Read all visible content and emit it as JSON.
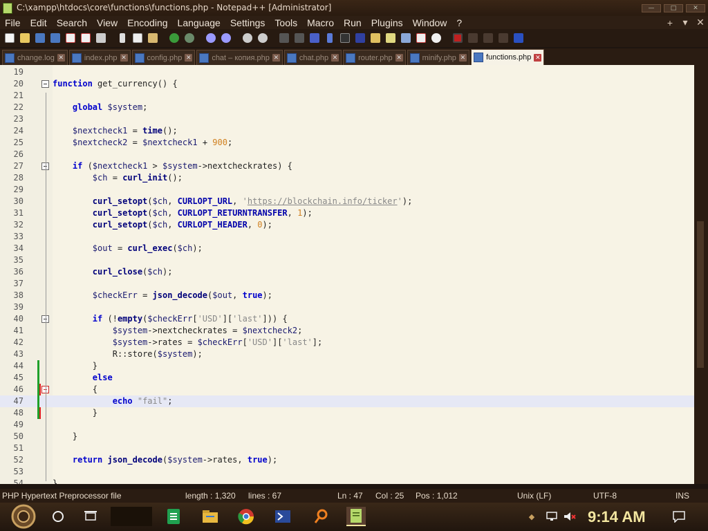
{
  "window": {
    "title": "C:\\xampp\\htdocs\\core\\functions\\functions.php - Notepad++ [Administrator]"
  },
  "menu": {
    "items": [
      "File",
      "Edit",
      "Search",
      "View",
      "Encoding",
      "Language",
      "Settings",
      "Tools",
      "Macro",
      "Run",
      "Plugins",
      "Window",
      "?"
    ],
    "right_controls": [
      "+",
      "▾",
      "✕"
    ]
  },
  "tabs": [
    {
      "label": "change.log",
      "active": false
    },
    {
      "label": "index.php",
      "active": false
    },
    {
      "label": "config.php",
      "active": false
    },
    {
      "label": "chat – копия.php",
      "active": false
    },
    {
      "label": "chat.php",
      "active": false
    },
    {
      "label": "router.php",
      "active": false
    },
    {
      "label": "minify.php",
      "active": false
    },
    {
      "label": "functions.php",
      "active": true
    }
  ],
  "editor": {
    "current_line": 47,
    "lines": [
      {
        "n": "19",
        "code": ""
      },
      {
        "n": "20",
        "code": "function get_currency() {"
      },
      {
        "n": "21",
        "code": ""
      },
      {
        "n": "22",
        "code": "    global $system;"
      },
      {
        "n": "23",
        "code": ""
      },
      {
        "n": "24",
        "code": "    $nextcheck1 = time();"
      },
      {
        "n": "25",
        "code": "    $nextcheck2 = $nextcheck1 + 900;"
      },
      {
        "n": "26",
        "code": ""
      },
      {
        "n": "27",
        "code": "    if ($nextcheck1 > $system->nextcheckrates) {"
      },
      {
        "n": "28",
        "code": "        $ch = curl_init();"
      },
      {
        "n": "29",
        "code": ""
      },
      {
        "n": "30",
        "code": "        curl_setopt($ch, CURLOPT_URL, 'https://blockchain.info/ticker');"
      },
      {
        "n": "31",
        "code": "        curl_setopt($ch, CURLOPT_RETURNTRANSFER, 1);"
      },
      {
        "n": "32",
        "code": "        curl_setopt($ch, CURLOPT_HEADER, 0);"
      },
      {
        "n": "33",
        "code": ""
      },
      {
        "n": "34",
        "code": "        $out = curl_exec($ch);"
      },
      {
        "n": "35",
        "code": ""
      },
      {
        "n": "36",
        "code": "        curl_close($ch);"
      },
      {
        "n": "37",
        "code": ""
      },
      {
        "n": "38",
        "code": "        $checkErr = json_decode($out, true);"
      },
      {
        "n": "39",
        "code": ""
      },
      {
        "n": "40",
        "code": "        if (!empty($checkErr['USD']['last'])) {"
      },
      {
        "n": "41",
        "code": "            $system->nextcheckrates = $nextcheck2;"
      },
      {
        "n": "42",
        "code": "            $system->rates = $checkErr['USD']['last'];"
      },
      {
        "n": "43",
        "code": "            R::store($system);"
      },
      {
        "n": "44",
        "code": "        }"
      },
      {
        "n": "45",
        "code": "        else"
      },
      {
        "n": "46",
        "code": "        {"
      },
      {
        "n": "47",
        "code": "            echo \"fail\";"
      },
      {
        "n": "48",
        "code": "        }"
      },
      {
        "n": "49",
        "code": ""
      },
      {
        "n": "50",
        "code": "    }"
      },
      {
        "n": "51",
        "code": ""
      },
      {
        "n": "52",
        "code": "    return json_decode($system->rates, true);"
      },
      {
        "n": "53",
        "code": ""
      },
      {
        "n": "54",
        "code": "}"
      }
    ]
  },
  "status": {
    "file_type": "PHP Hypertext Preprocessor file",
    "length": "length : 1,320",
    "lines": "lines : 67",
    "ln": "Ln : 47",
    "col": "Col : 25",
    "pos": "Pos : 1,012",
    "eol": "Unix (LF)",
    "encoding": "UTF-8",
    "mode": "INS"
  },
  "taskbar": {
    "clock": "9:14 AM"
  },
  "colors": {
    "accent": "#f3e6a0",
    "change_marker": "#1fa02a",
    "editor_bg": "#f7f3e5"
  }
}
